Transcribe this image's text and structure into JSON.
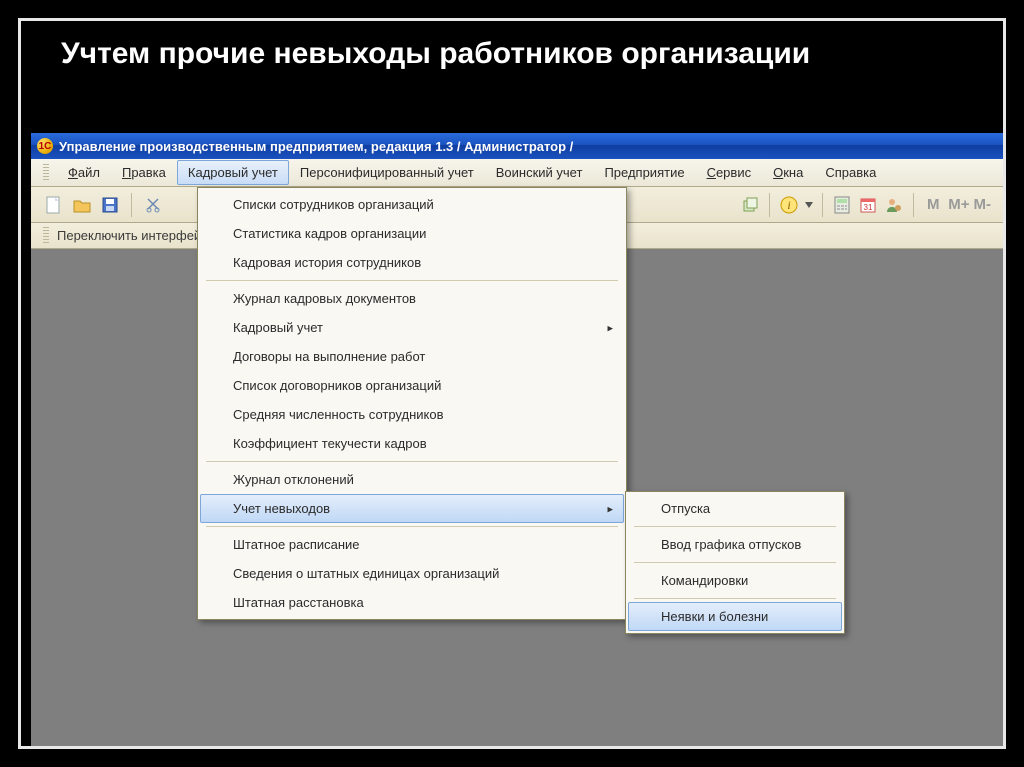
{
  "slide": {
    "title": "Учтем прочие невыходы работников организации"
  },
  "titlebar": {
    "text": "Управление производственным предприятием, редакция 1.3 / Администратор /"
  },
  "menubar": {
    "items": [
      {
        "label": "Файл",
        "u": "Ф"
      },
      {
        "label": "Правка",
        "u": "П"
      },
      {
        "label": "Кадровый учет",
        "u": "",
        "open": true
      },
      {
        "label": "Персонифицированный учет",
        "u": ""
      },
      {
        "label": "Воинский учет",
        "u": ""
      },
      {
        "label": "Предприятие",
        "u": ""
      },
      {
        "label": "Сервис",
        "u": "С"
      },
      {
        "label": "Окна",
        "u": "О"
      },
      {
        "label": "Справка",
        "u": ""
      }
    ]
  },
  "statusbar": {
    "text": "Переключить интерфейс"
  },
  "dropdown": {
    "groups": [
      [
        "Списки сотрудников организаций",
        "Статистика кадров организации",
        "Кадровая история сотрудников"
      ],
      [
        "Журнал кадровых документов",
        {
          "label": "Кадровый учет",
          "sub": true
        },
        "Договоры на выполнение работ",
        "Список договорников организаций",
        "Средняя численность сотрудников",
        "Коэффициент текучести кадров"
      ],
      [
        "Журнал отклонений",
        {
          "label": "Учет невыходов",
          "sub": true,
          "highlight": true
        }
      ],
      [
        "Штатное расписание",
        "Сведения о штатных единицах организаций",
        "Штатная расстановка"
      ]
    ]
  },
  "submenu": {
    "items": [
      "Отпуска",
      "Ввод графика отпусков",
      "Командировки",
      {
        "label": "Неявки и болезни",
        "highlight": true
      }
    ]
  },
  "icons": {
    "app": "1C",
    "m": "M",
    "mplus": "M+",
    "mminus": "M-"
  }
}
